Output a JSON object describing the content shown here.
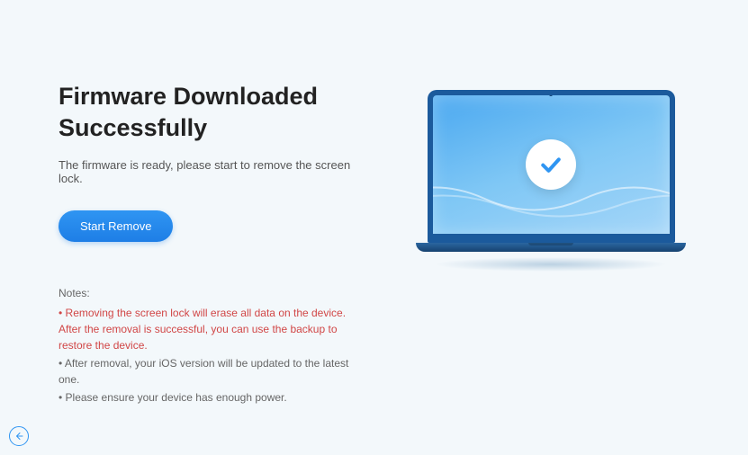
{
  "title": "Firmware Downloaded Successfully",
  "subtitle": "The firmware is ready, please start to remove the screen lock.",
  "button": {
    "start_label": "Start Remove"
  },
  "notes": {
    "label": "Notes:",
    "warning": "• Removing the screen lock will erase all data on the device. After the removal is successful, you can use the backup to restore the device.",
    "info1": "• After removal, your iOS version will be updated to the latest one.",
    "info2": "• Please ensure your device has enough power."
  },
  "colors": {
    "accent": "#2f95f2",
    "warning": "#d14646"
  }
}
